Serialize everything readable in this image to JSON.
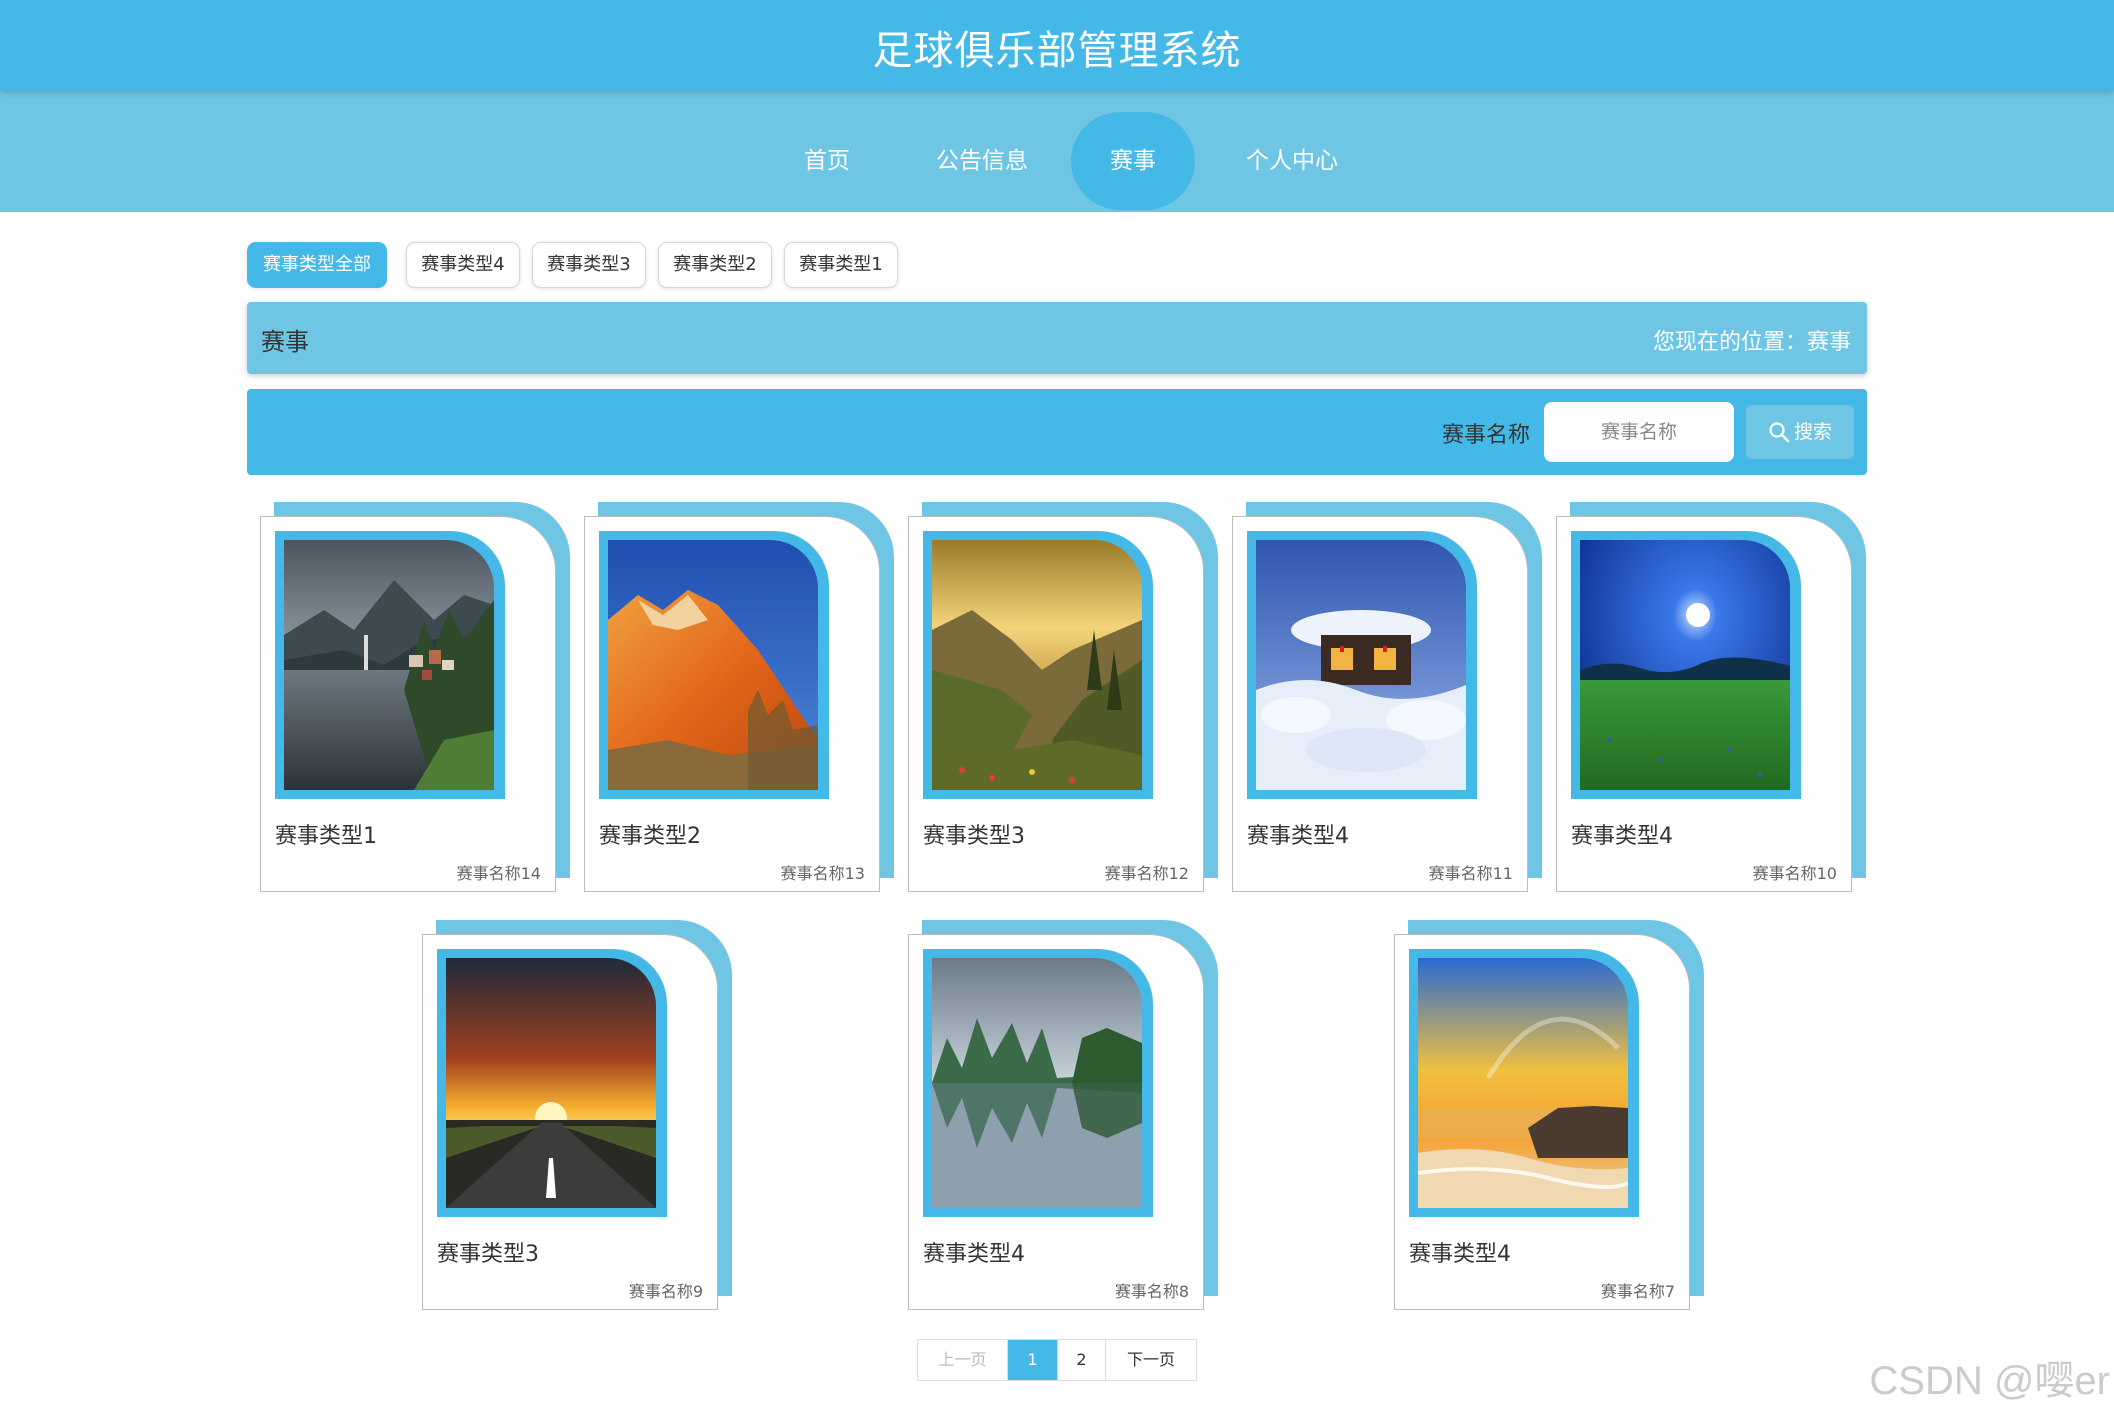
{
  "header": {
    "title": "足球俱乐部管理系统",
    "color": "#44b9e7"
  },
  "nav": {
    "items": [
      {
        "label": "首页"
      },
      {
        "label": "公告信息"
      },
      {
        "label": "赛事",
        "active": true
      },
      {
        "label": "个人中心"
      }
    ]
  },
  "categories": {
    "tabs": [
      {
        "label": "赛事类型全部",
        "active": true
      },
      {
        "label": "赛事类型4"
      },
      {
        "label": "赛事类型3"
      },
      {
        "label": "赛事类型2"
      },
      {
        "label": "赛事类型1"
      }
    ]
  },
  "breadcrumb": {
    "title": "赛事",
    "location": "您现在的位置：赛事"
  },
  "search": {
    "label": "赛事名称",
    "placeholder": "赛事名称",
    "value": "",
    "button": "搜索"
  },
  "cards": [
    {
      "type": "赛事类型1",
      "name": "赛事名称14",
      "scene": "lake-village"
    },
    {
      "type": "赛事类型2",
      "name": "赛事名称13",
      "scene": "red-mountain"
    },
    {
      "type": "赛事类型3",
      "name": "赛事名称12",
      "scene": "mountain-valley"
    },
    {
      "type": "赛事类型4",
      "name": "赛事名称11",
      "scene": "snow-house"
    },
    {
      "type": "赛事类型4",
      "name": "赛事名称10",
      "scene": "moon-meadow"
    },
    {
      "type": "赛事类型3",
      "name": "赛事名称9",
      "scene": "sunset-road"
    },
    {
      "type": "赛事类型4",
      "name": "赛事名称8",
      "scene": "karst-river"
    },
    {
      "type": "赛事类型4",
      "name": "赛事名称7",
      "scene": "beach-sunset"
    }
  ],
  "pagination": {
    "prev": "上一页",
    "pages": [
      "1",
      "2"
    ],
    "current": "1",
    "next": "下一页"
  },
  "watermark": "CSDN @嘤er",
  "colors": {
    "primary": "#44b9e7",
    "secondary": "#6ec6e4"
  }
}
